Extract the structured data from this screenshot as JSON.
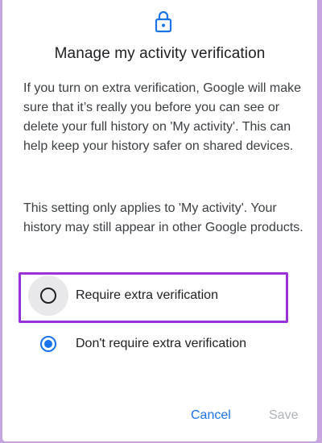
{
  "dialog": {
    "icon": "lock-icon",
    "title": "Manage my activity verification",
    "paragraph1": "If you turn on extra verification, Google will make sure that it’s really you before you can see or delete your full history on 'My activity'. This can help keep your history safer on shared devices.",
    "paragraph2": "This setting only applies to 'My activity'. Your history may still appear in other Google products.",
    "options": [
      {
        "label": "Require extra verification",
        "selected": false
      },
      {
        "label": "Don't require extra verification",
        "selected": true
      }
    ],
    "cancel_label": "Cancel",
    "save_label": "Save"
  },
  "colors": {
    "accent": "#1a73e8",
    "highlight": "#9b31d8",
    "disabled": "#b0b3b8"
  }
}
